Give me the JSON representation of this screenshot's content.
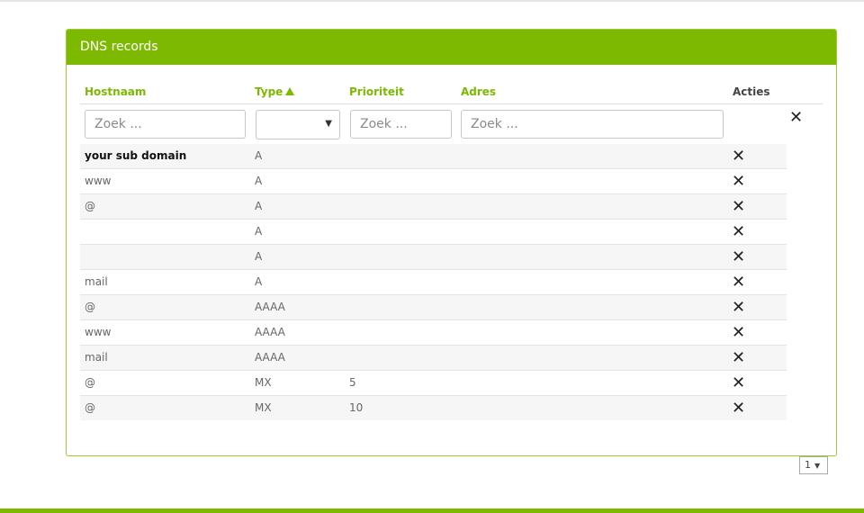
{
  "panel": {
    "title": "DNS records"
  },
  "columns": {
    "hostname": "Hostnaam",
    "type": "Type",
    "priority": "Prioriteit",
    "address": "Adres",
    "actions": "Acties"
  },
  "filters": {
    "hostname_placeholder": "Zoek ...",
    "type_selected": "",
    "priority_placeholder": "Zoek ...",
    "address_placeholder": "Zoek ..."
  },
  "icons": {
    "sort": "sort-ascending-triangle",
    "clear": "close-x",
    "delete": "close-x",
    "select_caret": "caret-down"
  },
  "records": [
    {
      "hostname": "your sub domain",
      "type": "A",
      "priority": "",
      "address": ""
    },
    {
      "hostname": "www",
      "type": "A",
      "priority": "",
      "address": ""
    },
    {
      "hostname": "@",
      "type": "A",
      "priority": "",
      "address": ""
    },
    {
      "hostname": "",
      "type": "A",
      "priority": "",
      "address": ""
    },
    {
      "hostname": "",
      "type": "A",
      "priority": "",
      "address": ""
    },
    {
      "hostname": "mail",
      "type": "A",
      "priority": "",
      "address": ""
    },
    {
      "hostname": "@",
      "type": "AAAA",
      "priority": "",
      "address": ""
    },
    {
      "hostname": "www",
      "type": "AAAA",
      "priority": "",
      "address": ""
    },
    {
      "hostname": "mail",
      "type": "AAAA",
      "priority": "",
      "address": ""
    },
    {
      "hostname": "@",
      "type": "MX",
      "priority": "5",
      "address": ""
    },
    {
      "hostname": "@",
      "type": "MX",
      "priority": "10",
      "address": ""
    }
  ],
  "pagination": {
    "current_page": "1"
  },
  "colors": {
    "accent": "#7cb900",
    "border": "#9ccc33"
  }
}
